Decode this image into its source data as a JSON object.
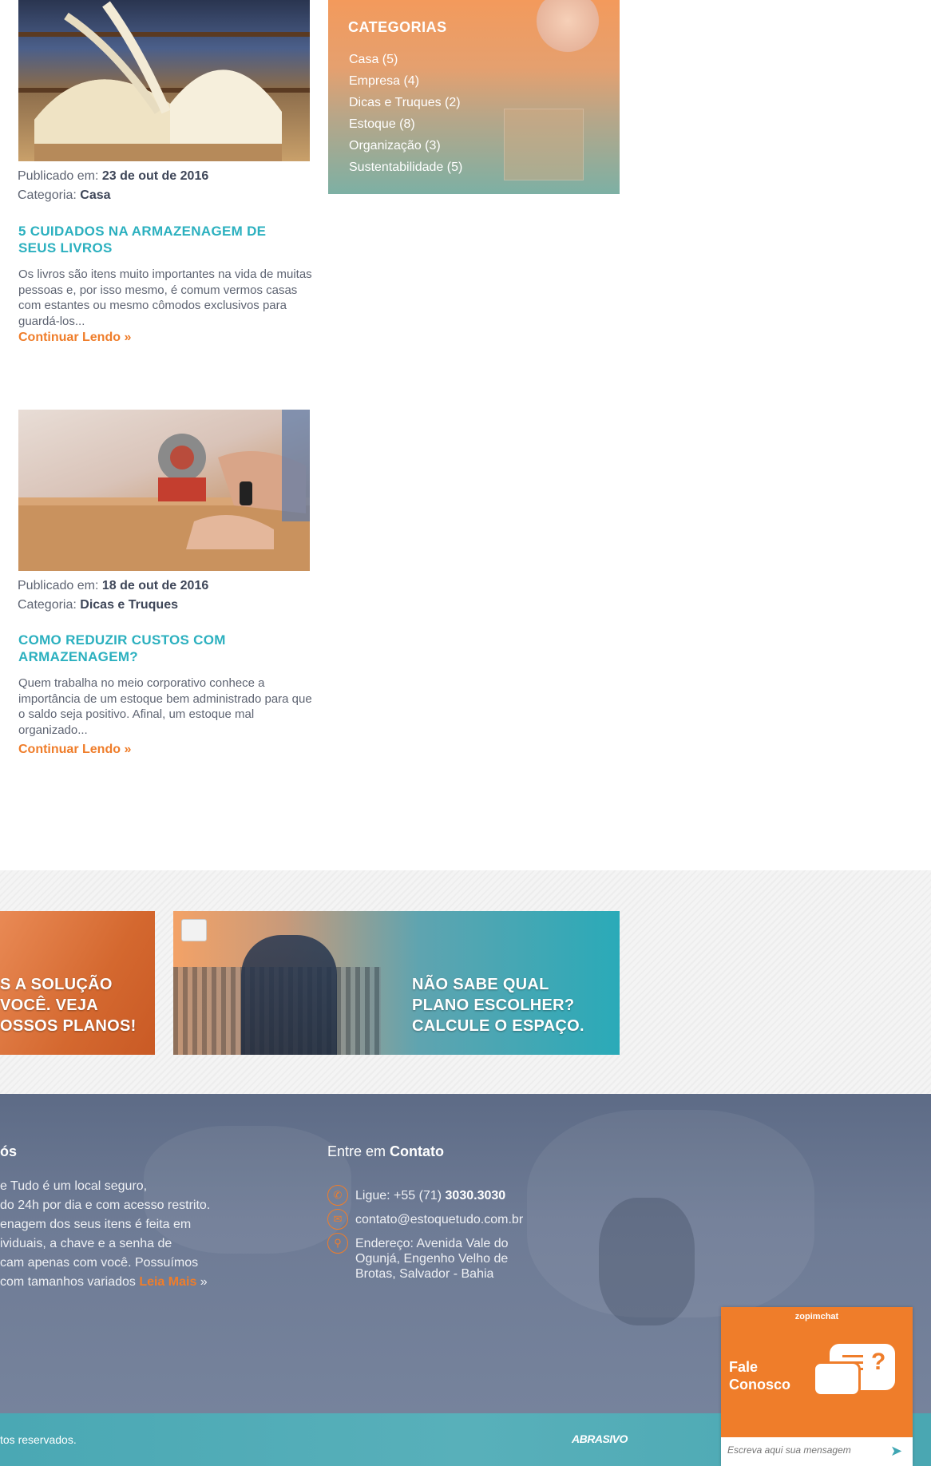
{
  "posts": [
    {
      "published_label": "Publicado em:",
      "date": "23 de out de 2016",
      "category_label": "Categoria:",
      "category": "Casa",
      "title": "5 CUIDADOS NA ARMAZENAGEM DE SEUS LIVROS",
      "excerpt": "Os livros são itens muito importantes na vida de muitas pessoas e, por isso mesmo, é comum vermos casas com estantes ou mesmo cômodos exclusivos para guardá-los...",
      "more": "Continuar Lendo",
      "more_icon": "»"
    },
    {
      "published_label": "Publicado em:",
      "date": "18 de out de 2016",
      "category_label": "Categoria:",
      "category": "Dicas e Truques",
      "title": "COMO REDUZIR CUSTOS COM ARMAZENAGEM?",
      "excerpt": "Quem trabalha no meio corporativo conhece a importância de um estoque bem administrado para que o saldo seja positivo. Afinal, um estoque mal organizado...",
      "more": "Continuar Lendo",
      "more_icon": "»"
    }
  ],
  "categories": {
    "heading": "CATEGORIAS",
    "items": [
      "Casa (5)",
      "Empresa (4)",
      "Dicas e Truques (2)",
      "Estoque (8)",
      "Organização (3)",
      "Sustentabilidade (5)"
    ]
  },
  "banners": {
    "left_lines": [
      "S A SOLUÇÃO",
      "VOCÊ. VEJA",
      "OSSOS PLANOS!"
    ],
    "right_lines": [
      "NÃO SABE QUAL",
      "PLANO ESCOLHER?",
      "CALCULE O ESPAÇO."
    ]
  },
  "footer": {
    "about_heading": "ós",
    "about_lines": [
      "e Tudo é um local seguro,",
      "do 24h por dia e com acesso restrito.",
      "enagem dos seus itens é feita em",
      "ividuais, a chave e a senha de",
      "cam apenas com você. Possuímos",
      "com tamanhos variados"
    ],
    "read_more": "Leia Mais",
    "read_more_suffix": "»",
    "contact_heading_pre": "Entre em",
    "contact_heading_bold": "Contato",
    "phone_label": "Ligue: +55 (71)",
    "phone_number": "3030.3030",
    "email": "contato@estoquetudo.com.br",
    "address": "Endereço: Avenida Vale do Ogunjá, Engenho Velho de Brotas, Salvador - Bahia",
    "copyright": "tos reservados.",
    "agency_logo": "ABRASIVO"
  },
  "chat": {
    "brand": "zopimchat",
    "title_line1": "Fale",
    "title_line2": "Conosco",
    "placeholder": "Escreva aqui sua mensagem"
  },
  "colors": {
    "accent_teal": "#2bb0bf",
    "accent_orange": "#ef7d2a",
    "footer_bg": "#6e7b95"
  }
}
